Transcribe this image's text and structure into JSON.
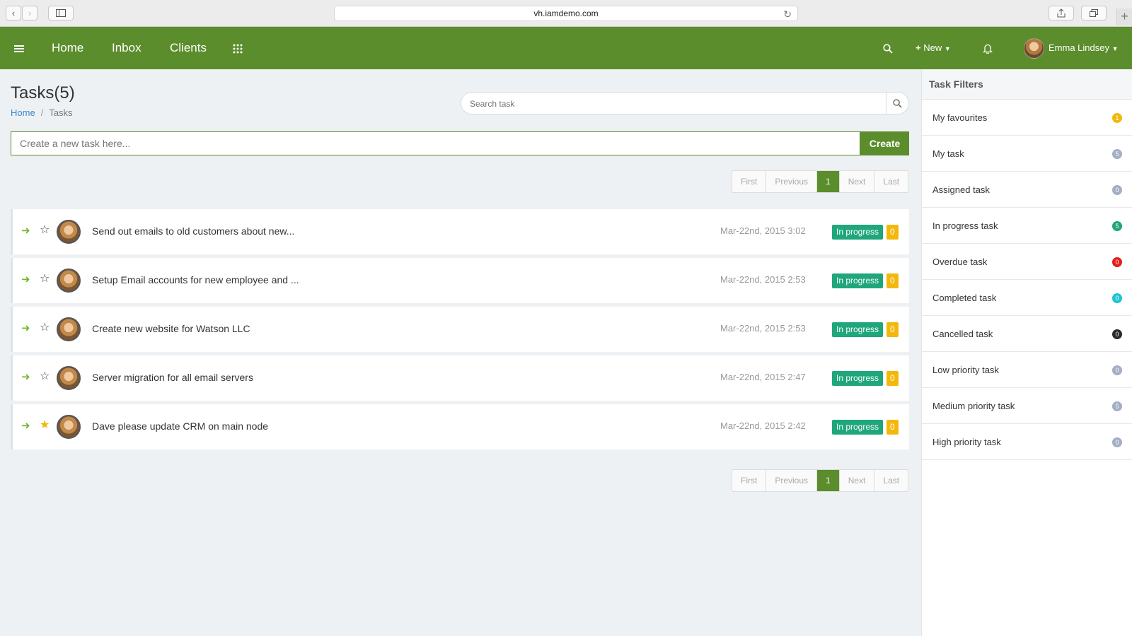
{
  "browser": {
    "url": "vh.iamdemo.com"
  },
  "nav": {
    "home": "Home",
    "inbox": "Inbox",
    "clients": "Clients",
    "new_label": "New",
    "user_name": "Emma Lindsey"
  },
  "page": {
    "title": "Tasks(5)",
    "breadcrumb": {
      "home": "Home",
      "current": "Tasks"
    },
    "search_placeholder": "Search task",
    "create_placeholder": "Create a new task here...",
    "create_button": "Create"
  },
  "pager": {
    "first": "First",
    "previous": "Previous",
    "current": "1",
    "next": "Next",
    "last": "Last"
  },
  "tasks": [
    {
      "title": "Send out emails to old customers about new...",
      "date": "Mar-22nd, 2015 3:02",
      "status": "In progress",
      "count": "0",
      "starred": false
    },
    {
      "title": "Setup Email accounts for new employee and ...",
      "date": "Mar-22nd, 2015 2:53",
      "status": "In progress",
      "count": "0",
      "starred": false
    },
    {
      "title": "Create new website for Watson LLC",
      "date": "Mar-22nd, 2015 2:53",
      "status": "In progress",
      "count": "0",
      "starred": false
    },
    {
      "title": "Server migration for all email servers",
      "date": "Mar-22nd, 2015 2:47",
      "status": "In progress",
      "count": "0",
      "starred": false
    },
    {
      "title": "Dave please update CRM on main node",
      "date": "Mar-22nd, 2015 2:42",
      "status": "In progress",
      "count": "0",
      "starred": true
    }
  ],
  "filters": {
    "heading": "Task Filters",
    "items": [
      {
        "label": "My favourites",
        "count": "1",
        "color": "#f3b80c"
      },
      {
        "label": "My task",
        "count": "5",
        "color": "#a4aec4"
      },
      {
        "label": "Assigned task",
        "count": "0",
        "color": "#a4aec4"
      },
      {
        "label": "In progress task",
        "count": "5",
        "color": "#1fa67a"
      },
      {
        "label": "Overdue task",
        "count": "0",
        "color": "#e02020"
      },
      {
        "label": "Completed task",
        "count": "0",
        "color": "#1ec5d0"
      },
      {
        "label": "Cancelled task",
        "count": "0",
        "color": "#2a2a2a"
      },
      {
        "label": "Low priority task",
        "count": "0",
        "color": "#a4aec4"
      },
      {
        "label": "Medium priority task",
        "count": "5",
        "color": "#a4aec4"
      },
      {
        "label": "High priority task",
        "count": "0",
        "color": "#a4aec4"
      }
    ]
  },
  "colors": {
    "brand": "#5b8d2c",
    "status_in_progress": "#1fa67a",
    "count_badge": "#f3b80c"
  }
}
